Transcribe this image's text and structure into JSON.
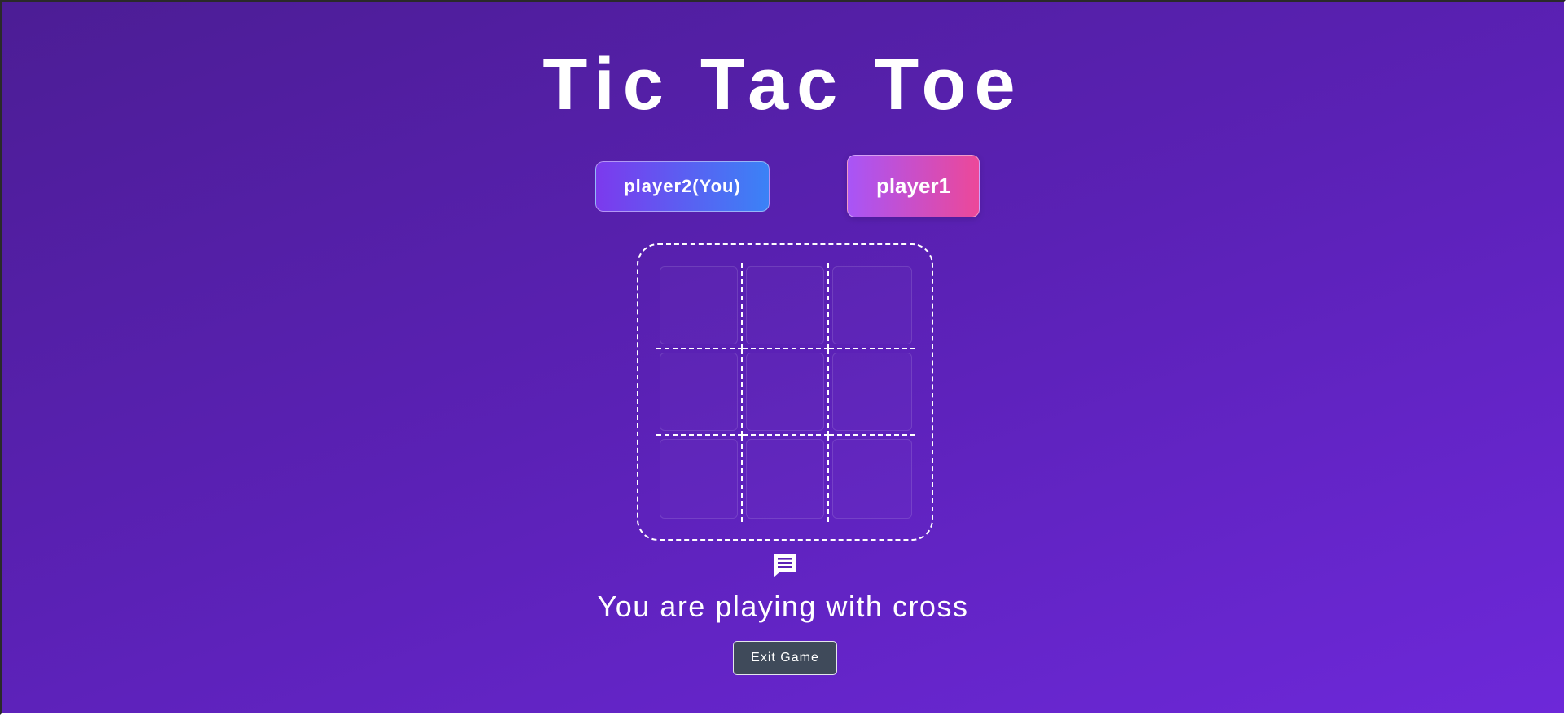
{
  "game": {
    "title": "Tic Tac Toe",
    "players": {
      "you": "player2(You)",
      "opponent": "player1"
    },
    "board": {
      "cells": [
        "",
        "",
        "",
        "",
        "",
        "",
        "",
        "",
        ""
      ]
    },
    "status": "You are playing with cross",
    "exit_label": "Exit Game",
    "chat_icon": "chat-icon"
  },
  "colors": {
    "background_gradient": [
      "#4c1d95",
      "#6d28d9"
    ],
    "you_badge_gradient": [
      "#7c3aed",
      "#3b82f6"
    ],
    "opponent_badge_gradient": [
      "#a855f7",
      "#ec4899"
    ],
    "exit_button": "#3f4a5a"
  }
}
